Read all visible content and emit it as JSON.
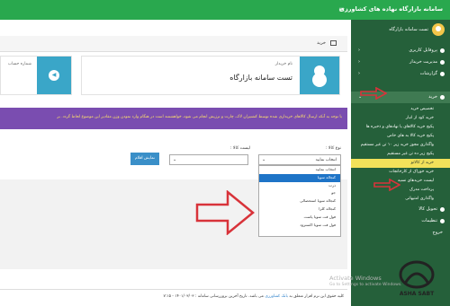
{
  "header": {
    "title": "سامانه بازارگاه نهاده های کشاورزی",
    "menu_icon": "hamburger-icon"
  },
  "sidebar": {
    "user_name": "تست سامانه بازارگاه",
    "items": [
      {
        "label": "پروفایل کاربری"
      },
      {
        "label": "مدیریت خریدار"
      },
      {
        "label": "گزارشات"
      },
      {
        "label": "خرید"
      }
    ],
    "subitems": [
      {
        "label": "تخصیص خرید"
      },
      {
        "label": "خرید کود از انبار"
      },
      {
        "label": "پکیج خرید کالاهای یا نهادهای و ذخیره ها"
      },
      {
        "label": "پکیج خرید کالا به های خاص"
      },
      {
        "label": "واگذاری مجوز خرید زیر ۱۰ تن غیر مستقیم"
      },
      {
        "label": "پکیج زیر ده تن غیر مستقیم"
      },
      {
        "label": "خرید از کالاتو"
      },
      {
        "label": "خرید خوراک از کارخانجات"
      },
      {
        "label": "لیست خریدهای نسیه"
      },
      {
        "label": "پرداخت مدرک"
      },
      {
        "label": "واگذاری امتیهاتی"
      }
    ],
    "more_items": [
      {
        "label": "تحویل کالا"
      },
      {
        "label": "تنظیمات"
      }
    ],
    "last_item": "خروج",
    "highlight_color": "#f2e15a"
  },
  "breadcrumb": {
    "label": "خرید"
  },
  "card_buyer": {
    "caption": "نام خریدار",
    "value": "تست سامانه بازارگاه"
  },
  "card_account": {
    "caption": "شماره حساب"
  },
  "notice": {
    "text": "با توجه به آنکه ارسال کالاهای خریداری شده توسط کشتیران لاک، چارت و ترزیش انجام می شود، خواهشمند است در هنگام وارد نمودن وزن مقادیر این موضوع لحاظ گردد. بر"
  },
  "form": {
    "type_label": "نوع کالا :",
    "list_label": "لیست کالا :",
    "type_value": "انتخاب نمایید",
    "show_button": "نمایش اقلام",
    "options": [
      "انتخاب نمایید",
      "کنجاله سویا",
      "ذرت",
      "جو",
      "کنجاله سویا استحصالی",
      "کنجاله کلزا",
      "فول فت سویا پاست",
      "فول فت سویا اکسترود"
    ],
    "selected_index": 1
  },
  "footer": {
    "prefix": "کلیه حقوق این نرم افزار متعلق به",
    "link": "بانک کشاورزی",
    "suffix": "می باشد. تاریخ آخرین بروزرسانی سامانه : ۱۴۰۱/۰۳/۰۳ - ۷:۱۵"
  },
  "watermark": {
    "activate": "Activate Windows",
    "activate_sub": "Go to Settings to activate Windows.",
    "brand": "ASHA SABT"
  },
  "colors": {
    "header_green": "#29a84e",
    "sidebar_green": "#25603a",
    "notice_purple": "#7a4db0",
    "info_blue": "#3aa6c8",
    "arrow_red": "#d8333a"
  }
}
